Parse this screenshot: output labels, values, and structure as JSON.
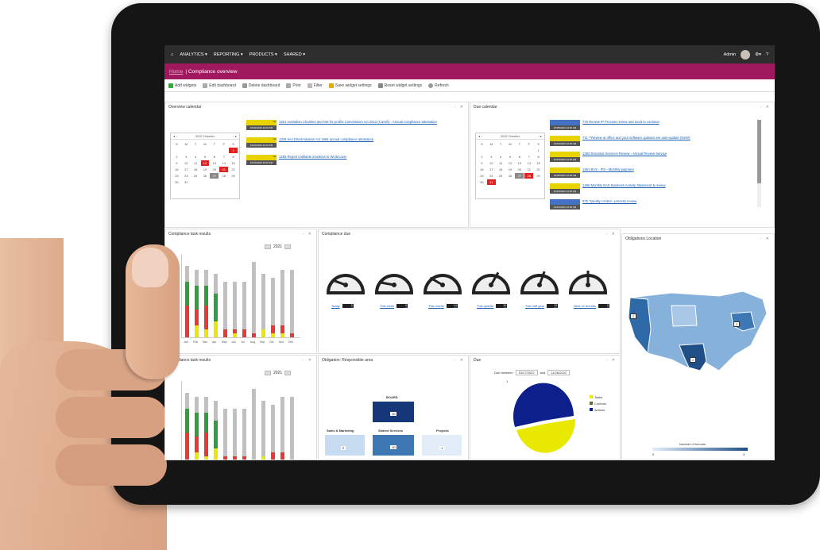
{
  "nav": {
    "home_icon": "home-icon",
    "items": [
      "ANALYTICS ▾",
      "REPORTING ▾",
      "PRODUCTS ▾",
      "SHARED ▾"
    ],
    "user": "Admin"
  },
  "page": {
    "breadcrumb": "Home",
    "title": "| Compliance overview"
  },
  "toolbar": [
    "Add widgets",
    "Edit dashboard",
    "Delete dashboard",
    "Print",
    "Filter",
    "Save widget settings",
    "Reset widget settings",
    "Refresh"
  ],
  "overview_calendar": {
    "title": "Overview calendar",
    "month": "2022 October",
    "days": [
      "S",
      "M",
      "T",
      "W",
      "T",
      "F",
      "S"
    ],
    "events": [
      {
        "tag": "Yes",
        "date": "10/31/2022 11:00 PM",
        "text": "1251 Australian Charities and Not-for-profits Commission Act 2012 (Cmnth) - Annual compliance attestation"
      },
      {
        "tag": "Yes",
        "date": "10/31/2022 11:00 PM",
        "text": "1325 Sex Discrimination Act 1984 annual compliance attestation"
      },
      {
        "tag": "Yes",
        "date": "10/31/2022 11:00 PM",
        "text": "1255 Report notifiable incidents to WorkCover"
      }
    ]
  },
  "due_calendar": {
    "title": "Due calendar",
    "month": "2022 October",
    "days": [
      "S",
      "M",
      "T",
      "W",
      "T",
      "F",
      "S"
    ],
    "events": [
      {
        "date": "10/28/2022 12:00 AM",
        "text": "775 Review IP Process review and need to continue"
      },
      {
        "date": "10/31/2022 12:00 AM",
        "text": "711 **Review at office and your software updates are auto-update (NSW)"
      },
      {
        "date": "10/31/2022 12:00 AM",
        "text": "1392 Essential Services Review - Annual Review Service"
      },
      {
        "date": "10/28/2022 12:00 AM",
        "text": "1451 BAS - IFS - Monthly payment"
      },
      {
        "date": "10/31/2022 12:00 AM",
        "text": "1465 Monthly BAS Business Activity Statement & review"
      },
      {
        "date": "10/31/2022 12:00 AM",
        "text": "975 *Quality control - process review"
      }
    ]
  },
  "task_results_1": {
    "title": "Compliance task results",
    "year": "2021",
    "months": [
      "Jan",
      "Feb",
      "Mar",
      "Apr",
      "May",
      "Jun",
      "Jul",
      "Aug",
      "Sep",
      "Oct",
      "Nov",
      "Dec"
    ]
  },
  "task_results_2": {
    "title": "Compliance task results",
    "year": "2021"
  },
  "compliance_due": {
    "title": "Compliance due",
    "gauges": [
      {
        "label": "Today",
        "value": "0"
      },
      {
        "label": "This week",
        "value": "0"
      },
      {
        "label": "This month",
        "value": "14"
      },
      {
        "label": "This quarter",
        "value": "10"
      },
      {
        "label": "This half year",
        "value": "13"
      },
      {
        "label": "Next 12 months",
        "value": "0"
      }
    ]
  },
  "obligations_location": {
    "title": "Obligations Location",
    "legend": "Number of records",
    "min": "0",
    "max": "3",
    "markers": [
      "2",
      "2",
      "2"
    ]
  },
  "responsible_area": {
    "title": "Obligation: Responsible area",
    "nodes": [
      {
        "label": "BOARD",
        "value": "10"
      },
      {
        "label": "Sales & Marketing",
        "value": "2"
      },
      {
        "label": "Shared Services",
        "value": "10"
      },
      {
        "label": "Projects",
        "value": "1"
      }
    ]
  },
  "due_pie": {
    "title": "Due",
    "due_between": "Due between",
    "from": "10/27/2022",
    "and": "and",
    "to": "11/26/2022",
    "legend": [
      "Tasks",
      "Controls",
      "Actions"
    ],
    "pie_label": "1",
    "colors": {
      "tasks": "#e8e800",
      "controls": "#556b2f",
      "actions": "#0d1f8a"
    }
  }
}
